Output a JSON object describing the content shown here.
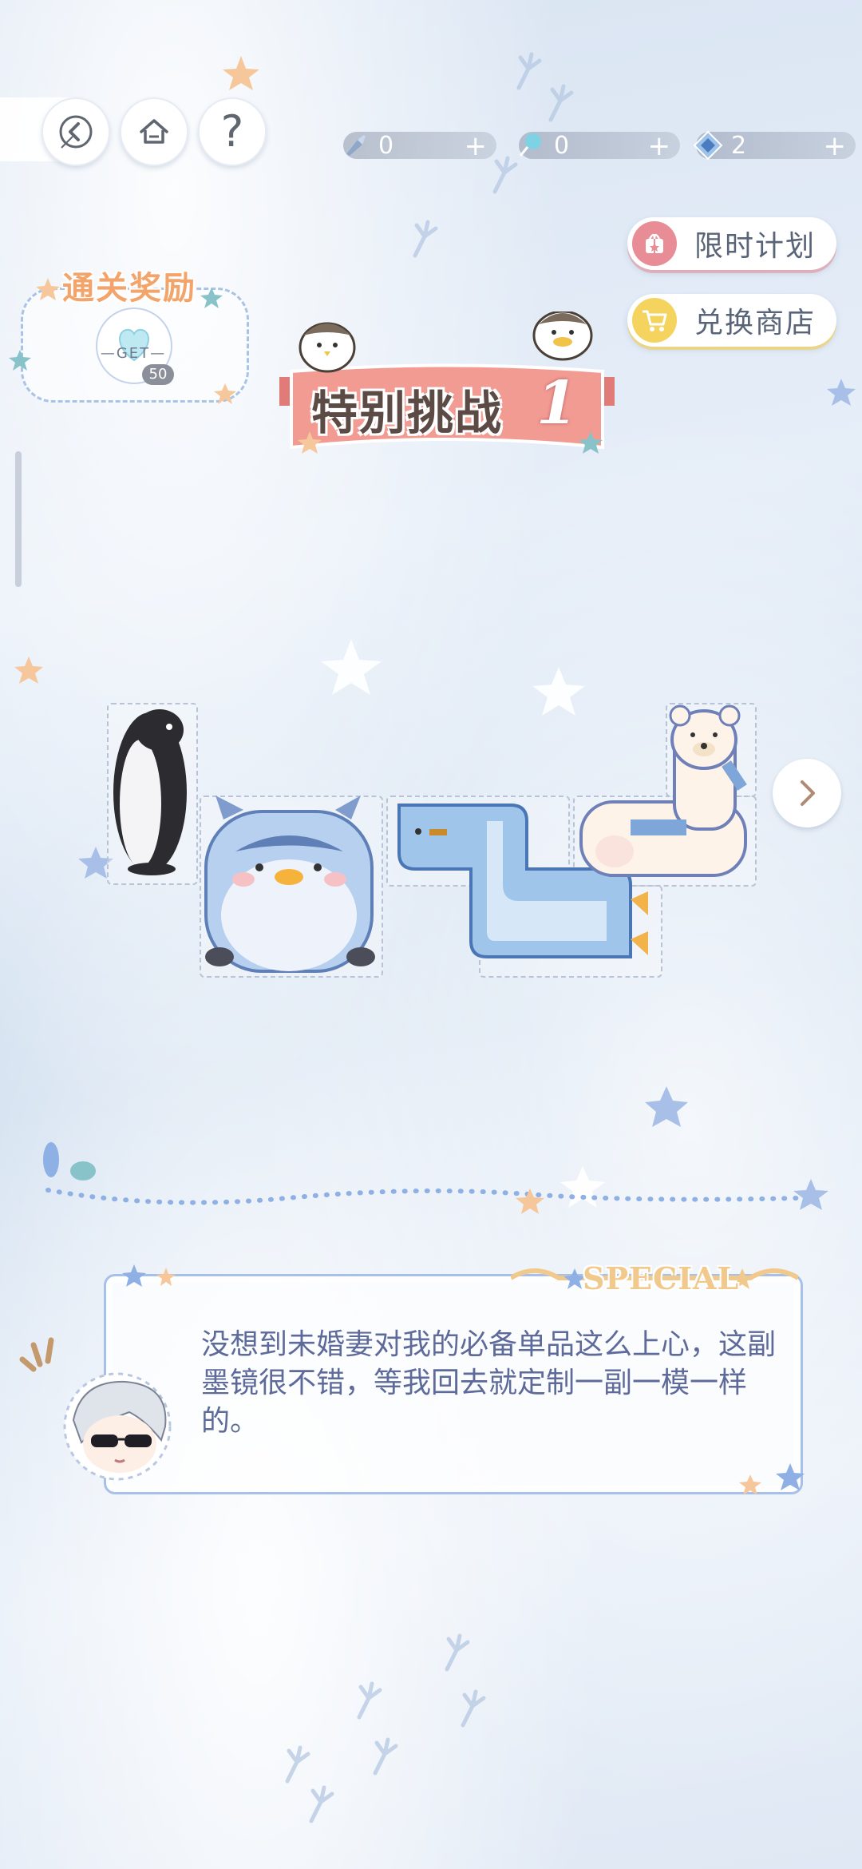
{
  "nav": {
    "back_icon": "back-arrow-icon",
    "home_icon": "home-icon",
    "help_label": "?"
  },
  "currencies": [
    {
      "icon": "brush-icon",
      "value": "0",
      "plus": "+"
    },
    {
      "icon": "lollipop-icon",
      "value": "0",
      "plus": "+"
    },
    {
      "icon": "crystal-icon",
      "value": "2",
      "plus": "+"
    }
  ],
  "side_buttons": {
    "limited_plan": "限时计划",
    "exchange_shop": "兑换商店"
  },
  "reward": {
    "title": "通关奖励",
    "get_label": "GET",
    "count": "50"
  },
  "stage": {
    "title": "特别挑战",
    "number": "1"
  },
  "dialogue": {
    "tag": "SPECIAL",
    "text": "没想到未婚妻对我的必备单品这么上心，这副墨镜很不错，等我回去就定制一副一模一样的。"
  },
  "colors": {
    "accent_pink": "#e88c96",
    "accent_yellow": "#f4d35e",
    "dialog_border": "#a7c0ea",
    "dialog_text": "#5d6a9a",
    "reward_title": "#f3a46b"
  }
}
